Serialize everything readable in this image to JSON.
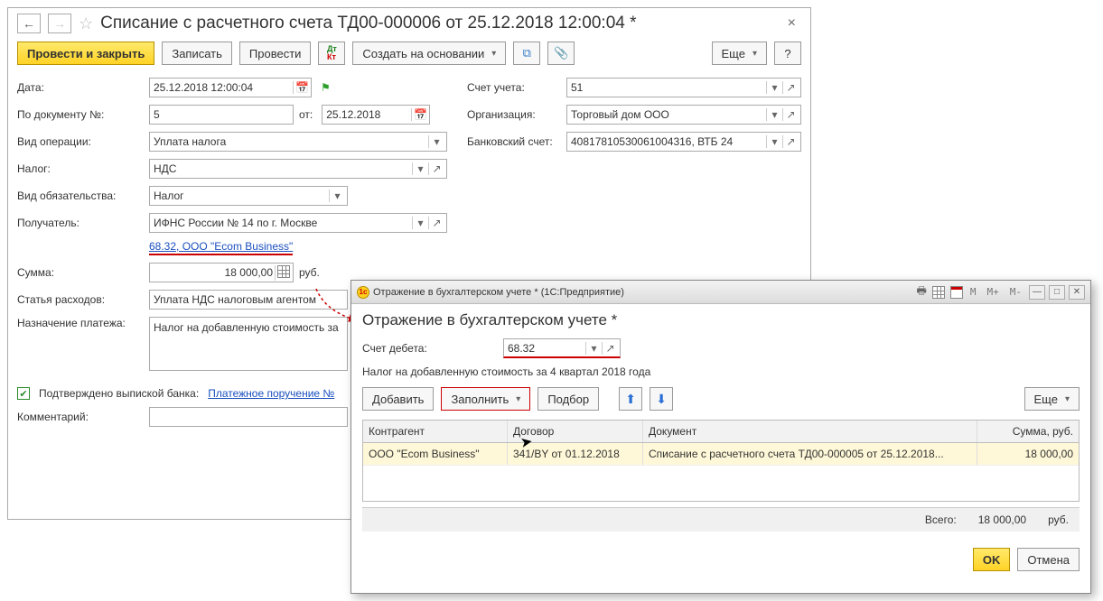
{
  "main": {
    "title": "Списание с расчетного счета ТД00-000006 от 25.12.2018 12:00:04 *",
    "toolbar": {
      "post_close": "Провести и закрыть",
      "save": "Записать",
      "post": "Провести",
      "create_based": "Создать на основании",
      "more": "Еще",
      "help": "?"
    },
    "labels": {
      "date": "Дата:",
      "by_doc": "По документу №:",
      "from": "от:",
      "op_type": "Вид операции:",
      "tax": "Налог:",
      "liab_type": "Вид обязательства:",
      "recipient": "Получатель:",
      "sum": "Сумма:",
      "currency": "руб.",
      "expense": "Статья расходов:",
      "purpose": "Назначение платежа:",
      "confirmed": "Подтверждено выпиской банка:",
      "payment_order": "Платежное поручение №",
      "comment": "Комментарий:",
      "account": "Счет учета:",
      "org": "Организация:",
      "bank_acc": "Банковский счет:"
    },
    "values": {
      "date": "25.12.2018 12:00:04",
      "doc_no": "5",
      "doc_date": "25.12.2018",
      "op_type": "Уплата налога",
      "tax": "НДС",
      "liab_type": "Налог",
      "recipient": "ИФНС России № 14 по г. Москве",
      "link": "68.32, ООО \"Ecom Business\"",
      "sum": "18 000,00",
      "expense": "Уплата НДС налоговым агентом",
      "purpose": "Налог на добавленную стоимость за",
      "account": "51",
      "org": "Торговый дом ООО",
      "bank_acc": "40817810530061004316, ВТБ 24"
    }
  },
  "popup": {
    "window_title": "Отражение в бухгалтерском учете *  (1С:Предприятие)",
    "title": "Отражение в бухгалтерском учете *",
    "labels": {
      "debit_acc": "Счет дебета:",
      "desc": "Налог на добавленную стоимость за 4 квартал 2018 года"
    },
    "values": {
      "debit_acc": "68.32"
    },
    "toolbar": {
      "add": "Добавить",
      "fill": "Заполнить",
      "pick": "Подбор",
      "more": "Еще"
    },
    "grid": {
      "headers": {
        "c1": "Контрагент",
        "c2": "Договор",
        "c3": "Документ",
        "c4": "Сумма, руб."
      },
      "row": {
        "c1": "ООО \"Ecom Business\"",
        "c2": "341/BY от 01.12.2018",
        "c3": "Списание с расчетного счета ТД00-000005 от 25.12.2018...",
        "c4": "18 000,00"
      }
    },
    "totals": {
      "label": "Всего:",
      "sum": "18 000,00",
      "cur": "руб."
    },
    "footer": {
      "ok": "OK",
      "cancel": "Отмена"
    },
    "m_btns": {
      "m": "M",
      "mplus": "M+",
      "mminus": "M-"
    }
  }
}
